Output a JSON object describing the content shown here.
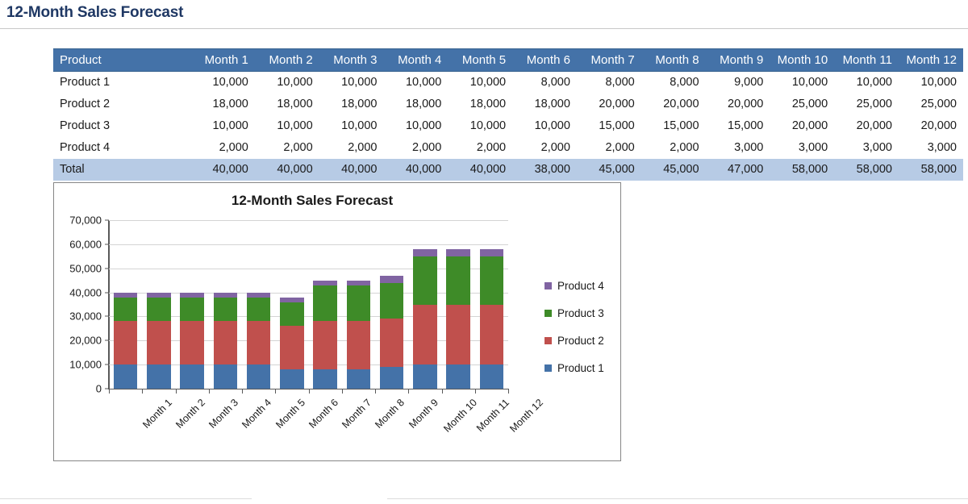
{
  "page": {
    "title": "12-Month Sales Forecast"
  },
  "table": {
    "columns": [
      "Product",
      "Month 1",
      "Month 2",
      "Month 3",
      "Month 4",
      "Month 5",
      "Month 6",
      "Month 7",
      "Month 8",
      "Month 9",
      "Month 10",
      "Month 11",
      "Month 12"
    ],
    "rows": [
      {
        "label": "Product 1",
        "values": [
          "10,000",
          "10,000",
          "10,000",
          "10,000",
          "10,000",
          "8,000",
          "8,000",
          "8,000",
          "9,000",
          "10,000",
          "10,000",
          "10,000"
        ],
        "total": false
      },
      {
        "label": "Product 2",
        "values": [
          "18,000",
          "18,000",
          "18,000",
          "18,000",
          "18,000",
          "18,000",
          "20,000",
          "20,000",
          "20,000",
          "25,000",
          "25,000",
          "25,000"
        ],
        "total": false
      },
      {
        "label": "Product 3",
        "values": [
          "10,000",
          "10,000",
          "10,000",
          "10,000",
          "10,000",
          "10,000",
          "15,000",
          "15,000",
          "15,000",
          "20,000",
          "20,000",
          "20,000"
        ],
        "total": false
      },
      {
        "label": "Product 4",
        "values": [
          "2,000",
          "2,000",
          "2,000",
          "2,000",
          "2,000",
          "2,000",
          "2,000",
          "2,000",
          "3,000",
          "3,000",
          "3,000",
          "3,000"
        ],
        "total": false
      },
      {
        "label": "Total",
        "values": [
          "40,000",
          "40,000",
          "40,000",
          "40,000",
          "40,000",
          "38,000",
          "45,000",
          "45,000",
          "47,000",
          "58,000",
          "58,000",
          "58,000"
        ],
        "total": true
      }
    ],
    "header_bg": "#4472A8",
    "total_bg": "#B7CBE5"
  },
  "chart_data": {
    "type": "bar",
    "stacked": true,
    "title": "12-Month Sales Forecast",
    "xlabel": "",
    "ylabel": "",
    "categories": [
      "Month 1",
      "Month 2",
      "Month 3",
      "Month 4",
      "Month 5",
      "Month 6",
      "Month 7",
      "Month 8",
      "Month 9",
      "Month 10",
      "Month 11",
      "Month 12"
    ],
    "series": [
      {
        "name": "Product 1",
        "color": "#4472A8",
        "values": [
          10000,
          10000,
          10000,
          10000,
          10000,
          8000,
          8000,
          8000,
          9000,
          10000,
          10000,
          10000
        ]
      },
      {
        "name": "Product 2",
        "color": "#C0504D",
        "values": [
          18000,
          18000,
          18000,
          18000,
          18000,
          18000,
          20000,
          20000,
          20000,
          25000,
          25000,
          25000
        ]
      },
      {
        "name": "Product 3",
        "color": "#3E8B28",
        "values": [
          10000,
          10000,
          10000,
          10000,
          10000,
          10000,
          15000,
          15000,
          15000,
          20000,
          20000,
          20000
        ]
      },
      {
        "name": "Product 4",
        "color": "#8064A2",
        "values": [
          2000,
          2000,
          2000,
          2000,
          2000,
          2000,
          2000,
          2000,
          3000,
          3000,
          3000,
          3000
        ]
      }
    ],
    "totals": [
      40000,
      40000,
      40000,
      40000,
      40000,
      38000,
      45000,
      45000,
      47000,
      58000,
      58000,
      58000
    ],
    "ylim": [
      0,
      70000
    ],
    "ytick_values": [
      0,
      10000,
      20000,
      30000,
      40000,
      50000,
      60000,
      70000
    ],
    "ytick_labels": [
      "0",
      "10,000",
      "20,000",
      "30,000",
      "40,000",
      "50,000",
      "60,000",
      "70,000"
    ],
    "grid": true,
    "legend_position": "right",
    "legend_order": [
      "Product 4",
      "Product 3",
      "Product 2",
      "Product 1"
    ]
  }
}
